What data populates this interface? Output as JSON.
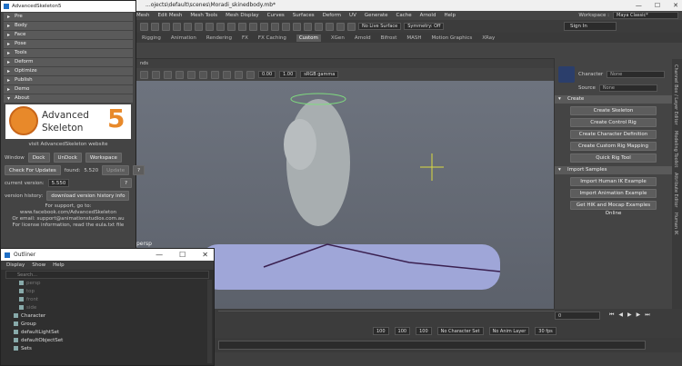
{
  "window": {
    "title_path": "...ojects\\default\\scenes\\Moradi_skinedbody.mb*",
    "controls": [
      "—",
      "☐",
      "✕"
    ]
  },
  "menubar": {
    "items": [
      "Mesh",
      "Edit Mesh",
      "Mesh Tools",
      "Mesh Display",
      "Curves",
      "Surfaces",
      "Deform",
      "UV",
      "Generate",
      "Cache",
      "Arnold",
      "Help"
    ],
    "workspace_label": "Workspace :",
    "workspace_value": "Maya Classic*"
  },
  "status": {
    "live_surface": "No Live Surface",
    "symmetry": "Symmetry: Off",
    "sign_in": "Sign In"
  },
  "shelf": {
    "tabs": [
      "Rigging",
      "Animation",
      "Rendering",
      "FX",
      "FX Caching",
      "Custom",
      "XGen",
      "Arnold",
      "Bifrost",
      "MASH",
      "Motion Graphics",
      "XRay"
    ],
    "active": "Custom"
  },
  "viewport": {
    "menu_fragment": "nds",
    "field1": "0.00",
    "field2": "1.00",
    "color_space": "sRGB gamma",
    "camera_label": "persp"
  },
  "character_panel": {
    "character_label": "Character",
    "character_value": "None",
    "source_label": "Source",
    "source_value": "None",
    "create_header": "Create",
    "create_buttons": [
      "Create Skeleton",
      "Create Control Rig",
      "Create Character Definition",
      "Create Custom Rig Mapping",
      "Quick Rig Tool"
    ],
    "import_header": "Import Samples",
    "import_buttons": [
      "Import Human IK Example",
      "Import Animation Example",
      "Get HIK and Mocap Examples Online"
    ]
  },
  "side_tabs": [
    "Channel Box / Layer Editor",
    "Modeling Toolkit",
    "Attribute Editor",
    "Human IK"
  ],
  "advanced_skeleton": {
    "title": "AdvancedSkeleton5",
    "sections": [
      "Pre",
      "Body",
      "Face",
      "Pose",
      "Tools",
      "Deform",
      "Optimize",
      "Publish",
      "Demo",
      "About"
    ],
    "logo_line1": "Advanced",
    "logo_line2": "Skeleton",
    "logo_digit": "5",
    "visit_link": "visit AdvancedSkeleton website",
    "window_label": "Window",
    "dock": "Dock",
    "undock": "UnDock",
    "workspace": "Workspace",
    "check_updates": "Check For Updates",
    "found_label": "found:",
    "found_value": "5.520",
    "update": "Update",
    "question": "?",
    "current_version_label": "current version:",
    "current_version_value": "5.550",
    "version_history_label": "version history:",
    "version_history_button": "download version history info",
    "support_lines": [
      "For support, go to:",
      "www.facebook.com/AdvancedSkeleton",
      "Or email: support@animationstudios.com.au",
      "For license information, read the eula.txt file"
    ]
  },
  "outliner": {
    "title": "Outliner",
    "menu": [
      "Display",
      "Show",
      "Help"
    ],
    "search_placeholder": "Search...",
    "items": [
      {
        "label": "persp",
        "dim": true
      },
      {
        "label": "top",
        "dim": true
      },
      {
        "label": "front",
        "dim": true
      },
      {
        "label": "side",
        "dim": true
      },
      {
        "label": "Character",
        "dim": false
      },
      {
        "label": "Group",
        "dim": false
      },
      {
        "label": "defaultLightSet",
        "dim": false
      },
      {
        "label": "defaultObjectSet",
        "dim": false
      },
      {
        "label": "Sets",
        "dim": false
      }
    ]
  },
  "timeline": {
    "frame_field": "0",
    "range_start": "100",
    "range_mid": "100",
    "range_end": "100",
    "no_character_set": "No Character Set",
    "no_anim_layer": "No Anim Layer",
    "fps": "30 fps"
  }
}
